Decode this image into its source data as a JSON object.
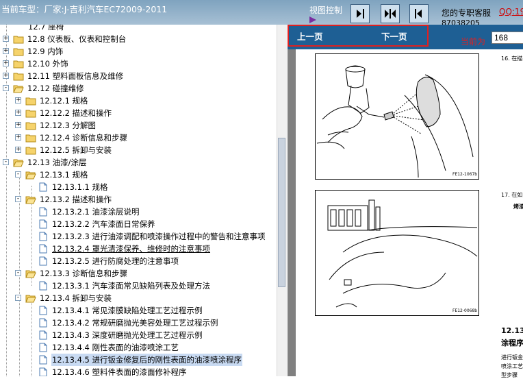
{
  "header": {
    "car_title": "当前车型：厂家:J-吉利汽车EC72009-2011",
    "view_control": "视图控制",
    "service_label": "您的专职客服",
    "service_qq": "QQ:19",
    "service_phone": "87038205"
  },
  "tree": {
    "top_partial": "12.7 座椅",
    "items": [
      {
        "id": "n128",
        "label": "12.8 仪表板、仪表和控制台",
        "toggle": "+"
      },
      {
        "id": "n129",
        "label": "12.9 内饰",
        "toggle": "+"
      },
      {
        "id": "n1210",
        "label": "12.10 外饰",
        "toggle": "+"
      },
      {
        "id": "n1211",
        "label": "12.11 塑料面板信息及维修",
        "toggle": "+"
      },
      {
        "id": "n1212",
        "label": "12.12 碰撞维修",
        "toggle": "-"
      },
      {
        "id": "n12121",
        "label": "12.12.1 规格",
        "toggle": "+"
      },
      {
        "id": "n12122",
        "label": "12.12.2 描述和操作",
        "toggle": "+"
      },
      {
        "id": "n12123",
        "label": "12.12.3 分解图",
        "toggle": "+"
      },
      {
        "id": "n12124",
        "label": "12.12.4 诊断信息和步骤",
        "toggle": "+"
      },
      {
        "id": "n12125",
        "label": "12.12.5 拆卸与安装",
        "toggle": "+"
      },
      {
        "id": "n1213",
        "label": "12.13 油漆/涂层",
        "toggle": "-"
      },
      {
        "id": "n12131",
        "label": "12.13.1 规格",
        "toggle": "-"
      },
      {
        "id": "n121311",
        "label": "12.13.1.1 规格",
        "toggle": ""
      },
      {
        "id": "n12132",
        "label": "12.13.2 描述和操作",
        "toggle": "-"
      },
      {
        "id": "n121321",
        "label": "12.13.2.1 油漆涂层说明",
        "toggle": ""
      },
      {
        "id": "n121322",
        "label": "12.13.2.2 汽车漆面日常保养",
        "toggle": ""
      },
      {
        "id": "n121323",
        "label": "12.13.2.3 进行油漆调配和喷漆操作过程中的警告和注意事项",
        "toggle": ""
      },
      {
        "id": "n121324",
        "label": "12.13.2.4 罩光清漆保养、维修时的注意事项",
        "toggle": ""
      },
      {
        "id": "n121325",
        "label": "12.13.2.5 进行防腐处理的注意事项",
        "toggle": ""
      },
      {
        "id": "n12133",
        "label": "12.13.3 诊断信息和步骤",
        "toggle": "-"
      },
      {
        "id": "n121331",
        "label": "12.13.3.1 汽车漆面常见缺陷列表及处理方法",
        "toggle": ""
      },
      {
        "id": "n12134",
        "label": "12.13.4 拆卸与安装",
        "toggle": "-"
      },
      {
        "id": "n121341",
        "label": "12.13.4.1 常见漆膜缺陷处理工艺过程示例",
        "toggle": ""
      },
      {
        "id": "n121342",
        "label": "12.13.4.2 常规研磨抛光美容处理工艺过程示例",
        "toggle": ""
      },
      {
        "id": "n121343",
        "label": "12.13.4.3 深度研磨抛光处理工艺过程示例",
        "toggle": ""
      },
      {
        "id": "n121344",
        "label": "12.13.4.4 刚性表面的油漆喷涂工艺",
        "toggle": ""
      },
      {
        "id": "n121345",
        "label": "12.13.4.5 进行钣金修复后的刚性表面的油漆喷涂程序",
        "toggle": ""
      },
      {
        "id": "n121346",
        "label": "12.13.4.6 塑料件表面的漆面修补程序",
        "toggle": ""
      }
    ]
  },
  "nav": {
    "prev_label": "上一页",
    "next_label": "下一页",
    "current_label": "当前为",
    "current_page": "168"
  },
  "document": {
    "step16": "16.  在描",
    "fig1_caption": "FE12-1067b",
    "step17": "17.  在如",
    "step17_sub": "烤漆",
    "fig2_caption": "FE12-0068b",
    "section_num": "12.13.",
    "section_title": "涂程序",
    "body_line1": "进行钣金",
    "body_line2": "喷涂工艺",
    "body_line3": "型步骤"
  },
  "colors": {
    "nav_bg": "#1e5f94",
    "highlight_border": "#e02020",
    "selected_bg": "#c8daf2"
  }
}
